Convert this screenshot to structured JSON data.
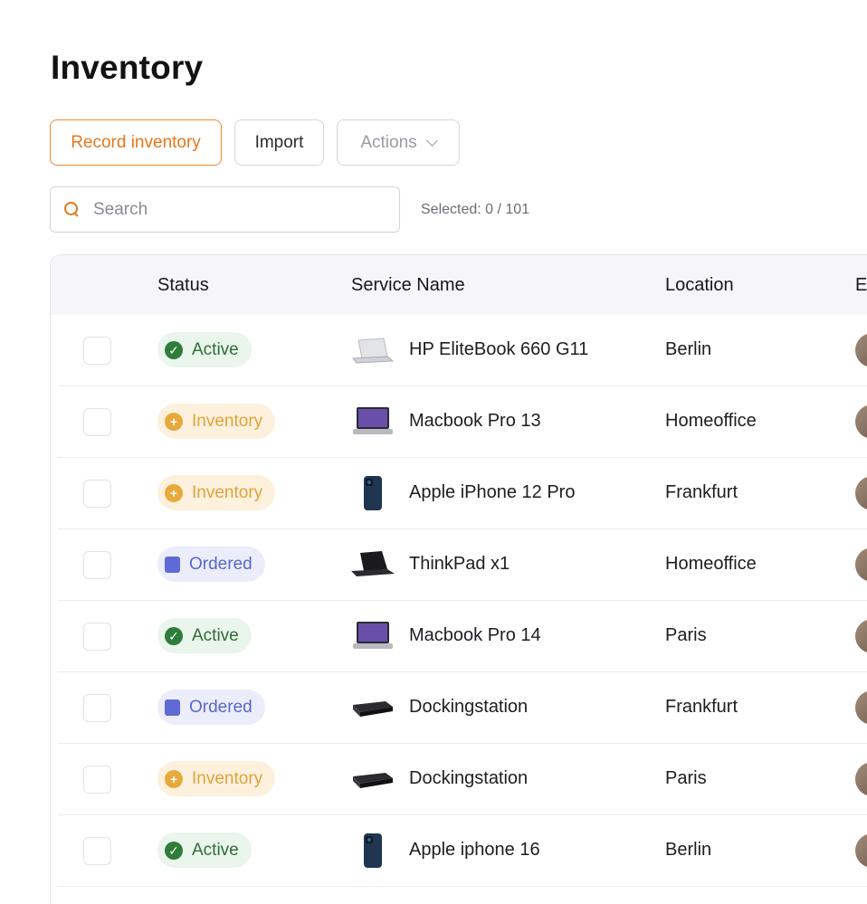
{
  "page": {
    "title": "Inventory"
  },
  "toolbar": {
    "record_label": "Record inventory",
    "import_label": "Import",
    "actions_label": "Actions"
  },
  "search": {
    "placeholder": "Search"
  },
  "selection": {
    "text": "Selected: 0 / 101"
  },
  "table": {
    "columns": [
      "Status",
      "Service Name",
      "Location",
      "E"
    ],
    "rows": [
      {
        "status": "Active",
        "status_type": "active",
        "service": "HP EliteBook 660 G11",
        "device_icon": "laptop-silver-icon",
        "location": "Berlin"
      },
      {
        "status": "Inventory",
        "status_type": "inventory",
        "service": "Macbook Pro 13",
        "device_icon": "macbook-icon",
        "location": "Homeoffice"
      },
      {
        "status": "Inventory",
        "status_type": "inventory",
        "service": "Apple iPhone 12 Pro",
        "device_icon": "iphone-icon",
        "location": "Frankfurt"
      },
      {
        "status": "Ordered",
        "status_type": "ordered",
        "service": "ThinkPad x1",
        "device_icon": "thinkpad-icon",
        "location": "Homeoffice"
      },
      {
        "status": "Active",
        "status_type": "active",
        "service": "Macbook Pro 14",
        "device_icon": "macbook-icon",
        "location": "Paris"
      },
      {
        "status": "Ordered",
        "status_type": "ordered",
        "service": "Dockingstation",
        "device_icon": "dock-icon",
        "location": "Frankfurt"
      },
      {
        "status": "Inventory",
        "status_type": "inventory",
        "service": "Dockingstation",
        "device_icon": "dock-icon",
        "location": "Paris"
      },
      {
        "status": "Active",
        "status_type": "active",
        "service": "Apple iphone 16",
        "device_icon": "iphone-icon",
        "location": "Berlin"
      }
    ]
  },
  "colors": {
    "accent": "#e8761a",
    "active": "#2e7d3a",
    "inventory": "#e8a93b",
    "ordered": "#5f6ad6"
  }
}
